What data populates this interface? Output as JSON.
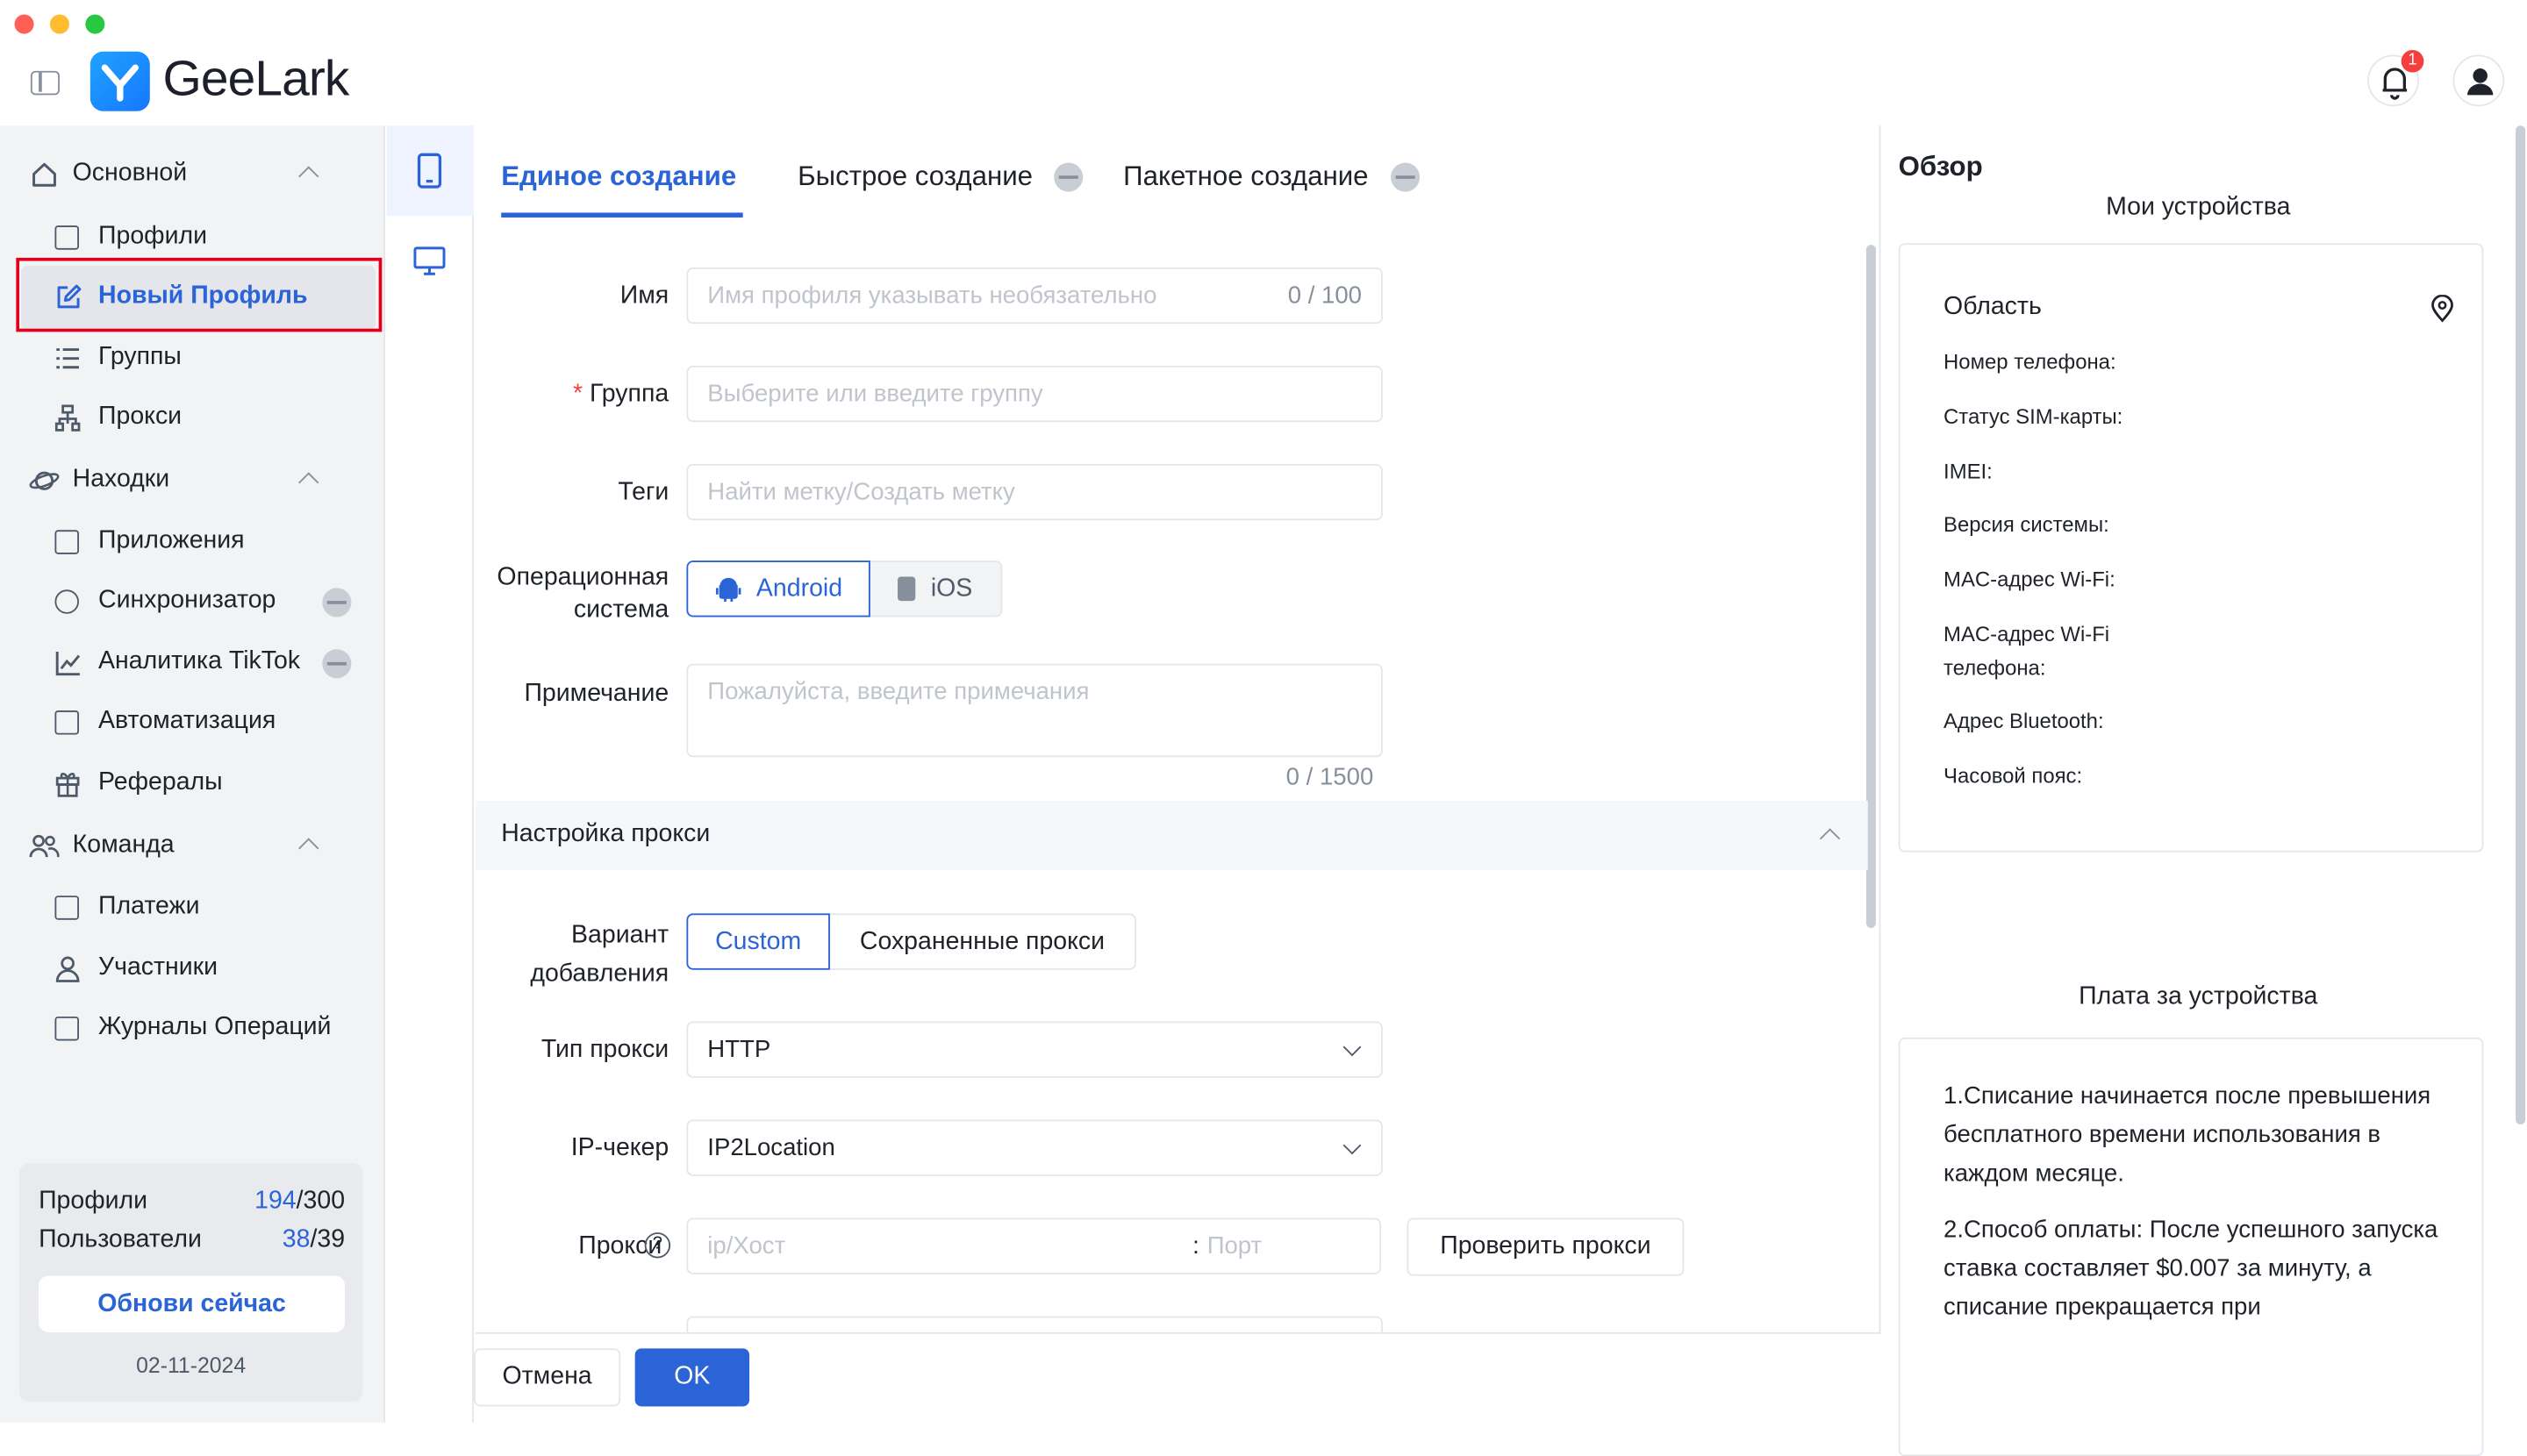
{
  "app": {
    "brand": "GeeLark",
    "notification_count": "1"
  },
  "sidebar": {
    "sections": [
      {
        "label": "Основной",
        "items": [
          "Профили",
          "Новый Профиль",
          "Группы",
          "Прокси"
        ]
      },
      {
        "label": "Находки",
        "items": [
          "Приложения",
          "Синхронизатор",
          "Аналитика TikTok",
          "Автоматизация",
          "Рефералы"
        ]
      },
      {
        "label": "Команда",
        "items": [
          "Платежи",
          "Участники",
          "Журналы Операций"
        ]
      }
    ],
    "active_item": "Новый Профиль",
    "stats": {
      "profiles_label": "Профили",
      "profiles_used": "194",
      "profiles_total": "/300",
      "users_label": "Пользователи",
      "users_used": "38",
      "users_total": "/39",
      "upgrade_label": "Обнови сейчас",
      "date": "02-11-2024"
    }
  },
  "tabs": [
    "Единое создание",
    "Быстрое создание",
    "Пакетное создание"
  ],
  "form": {
    "name_label": "Имя",
    "name_placeholder": "Имя профиля указывать необязательно",
    "name_counter": "0 / 100",
    "group_required": "*",
    "group_label": "Группа",
    "group_placeholder": "Выберите или введите группу",
    "tags_label": "Теги",
    "tags_placeholder": "Найти метку/Создать метку",
    "os_label_1": "Операционная",
    "os_label_2": "система",
    "os_android": "Android",
    "os_ios": "iOS",
    "note_label": "Примечание",
    "note_placeholder": "Пожалуйста, введите примечания",
    "note_counter": "0 / 1500",
    "proxy_section": "Настройка прокси",
    "add_variant_label_1": "Вариант",
    "add_variant_label_2": "добавления",
    "variant_custom": "Custom",
    "variant_saved": "Сохраненные прокси",
    "proxy_type_label": "Тип прокси",
    "proxy_type_value": "HTTP",
    "ip_checker_label": "IP-чекер",
    "ip_checker_value": "IP2Location",
    "proxy_label": "Прокси",
    "proxy_host_placeholder": "ip/Хост",
    "proxy_port_sep": ":",
    "proxy_port_placeholder": "Порт",
    "check_proxy_label": "Проверить прокси"
  },
  "footer": {
    "cancel": "Отмена",
    "ok": "OK"
  },
  "overview": {
    "title": "Обзор",
    "devices_title": "Мои устройства",
    "region_label": "Область",
    "fields": [
      "Номер телефона:",
      "Статус SIM-карты:",
      "IMEI:",
      "Версия системы:",
      "MAC-адрес Wi-Fi:",
      "MAC-адрес Wi-Fi",
      "телефона:",
      "Адрес Bluetooth:",
      "Часовой пояс:"
    ],
    "fees_title": "Плата за устройства",
    "fee_note_1": "1.Списание начинается после превышения бесплатного времени использования в каждом месяце.",
    "fee_note_2": "2.Способ оплаты: После успешного запуска ставка составляет $0.007 за минуту, а списание прекращается при"
  },
  "colors": {
    "accent": "#2b64d6",
    "highlight_border": "#e0001b",
    "badge": "#f53f3f"
  }
}
